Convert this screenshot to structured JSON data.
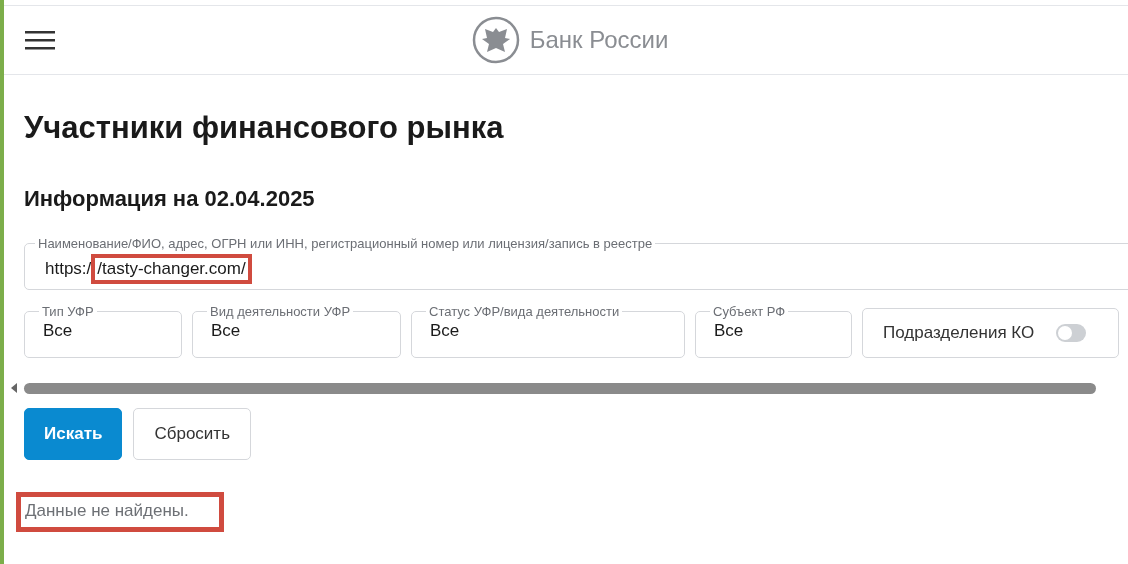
{
  "header": {
    "logo_text": "Банк России"
  },
  "title": "Участники финансового рынка",
  "subtitle": "Информация на 02.04.2025",
  "search": {
    "label": "Наименование/ФИО, адрес, ОГРН или ИНН, регистрационный номер или лицензия/запись в реестре",
    "value_parts": [
      {
        "text": "https:/",
        "highlighted": false
      },
      {
        "text": "/tasty-changer.com/",
        "highlighted": true
      }
    ]
  },
  "filters": [
    {
      "kind": "select",
      "label": "Тип УФР",
      "value": "Все"
    },
    {
      "kind": "select",
      "label": "Вид деятельности УФР",
      "value": "Все"
    },
    {
      "kind": "select",
      "label": "Статус УФР/вида деятельности",
      "value": "Все"
    },
    {
      "kind": "select",
      "label": "Субъект РФ",
      "value": "Все"
    },
    {
      "kind": "toggle",
      "label": "Подразделения КО",
      "on": false
    }
  ],
  "buttons": [
    {
      "label": "Искать",
      "primary": true
    },
    {
      "label": "Сбросить",
      "primary": false
    }
  ],
  "message": {
    "text": "Данные не найдены.",
    "highlighted": true
  }
}
